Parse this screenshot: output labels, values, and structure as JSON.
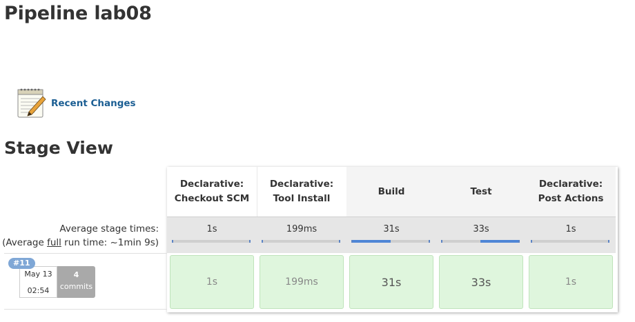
{
  "page": {
    "title": "Pipeline lab08"
  },
  "sidebar": {
    "recent_changes": "Recent Changes",
    "recent_changes_icon": "notepad-icon"
  },
  "stage_view": {
    "title": "Stage View",
    "avg_label_line1": "Average stage times:",
    "avg_label_prefix": "(Average ",
    "avg_label_full": "full",
    "avg_label_suffix": " run time: ~1min 9s)",
    "stages": [
      {
        "name_line1": "Declarative:",
        "name_line2": "Checkout SCM",
        "avg": "1s",
        "progress": 0.0,
        "cell": "1s"
      },
      {
        "name_line1": "Declarative:",
        "name_line2": "Tool Install",
        "avg": "199ms",
        "progress": 0.0,
        "cell": "199ms"
      },
      {
        "name_line1": "Build",
        "name_line2": "",
        "avg": "31s",
        "progress": 0.5,
        "cell": "31s"
      },
      {
        "name_line1": "Test",
        "name_line2": "",
        "avg": "33s",
        "progress": 0.5,
        "cell": "33s"
      },
      {
        "name_line1": "Declarative:",
        "name_line2": "Post Actions",
        "avg": "1s",
        "progress": 0.0,
        "cell": "1s"
      }
    ],
    "build": {
      "number": "#11",
      "date": "May 13",
      "time": "02:54",
      "commits_count": "4",
      "commits_label": "commits"
    }
  },
  "colors": {
    "link": "#1b5e93",
    "success_cell": "#dff6dd",
    "progress": "#4f86d6",
    "badge": "#7fa7d6"
  }
}
